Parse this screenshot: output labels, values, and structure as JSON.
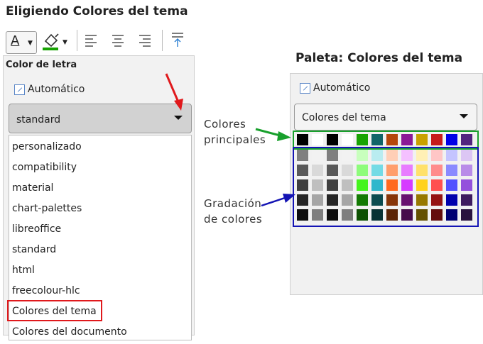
{
  "left": {
    "heading": "Eligiendo Colores del tema",
    "panel_label": "Color de letra",
    "auto_label": "Automático",
    "combo_value": "standard",
    "toolbar_icon_text": "A",
    "options": [
      "personalizado",
      "compatibility",
      "material",
      "chart-palettes",
      "libreoffice",
      "standard",
      "html",
      "freecolour-hlc",
      "Colores del tema",
      "Colores del documento"
    ]
  },
  "right": {
    "heading": "Paleta: Colores del tema",
    "auto_label": "Automático",
    "combo_value": "Colores del tema",
    "annot_main": [
      "Colores",
      "principales"
    ],
    "annot_grad": [
      "Gradación",
      "de colores"
    ]
  },
  "colors": {
    "main_row": [
      "#000000",
      "#ffffff",
      "#000000",
      "#ffffff",
      "#18a303",
      "#106468",
      "#b4470b",
      "#8b1896",
      "#c9a000",
      "#c71a1a",
      "#0000e6",
      "#53247f"
    ],
    "grad_rows": [
      [
        "#7f7f7f",
        "#f2f2f2",
        "#7f7f7f",
        "#f2f2f2",
        "#c8ffbd",
        "#b9ecf0",
        "#ffcfb6",
        "#f4c0ff",
        "#fff0b5",
        "#ffc6c6",
        "#c4c4ff",
        "#dcc6f4"
      ],
      [
        "#595959",
        "#d9d9d9",
        "#595959",
        "#d9d9d9",
        "#8efc7b",
        "#74dbe5",
        "#ff9e6c",
        "#e87cff",
        "#ffe16b",
        "#ff8c8c",
        "#8a8aff",
        "#b98ce8"
      ],
      [
        "#3f3f3f",
        "#bfbfbf",
        "#3f3f3f",
        "#bfbfbf",
        "#44f41c",
        "#2fb7cc",
        "#ff6a1e",
        "#d63bff",
        "#ffd21c",
        "#ff5050",
        "#5050ff",
        "#9450dc"
      ],
      [
        "#262626",
        "#a6a6a6",
        "#262626",
        "#a6a6a6",
        "#137a03",
        "#0b4b4f",
        "#873508",
        "#681270",
        "#977800",
        "#951313",
        "#0000ad",
        "#3e1b5f"
      ],
      [
        "#0d0d0d",
        "#7f7f7f",
        "#0d0d0d",
        "#7f7f7f",
        "#0d5102",
        "#083234",
        "#5a2405",
        "#460c4b",
        "#645000",
        "#640d0d",
        "#000073",
        "#29123f"
      ]
    ],
    "red_arrow": "#e0191c",
    "green": "#18a02c",
    "blue": "#1414b4",
    "underline_color": "#18a303"
  }
}
